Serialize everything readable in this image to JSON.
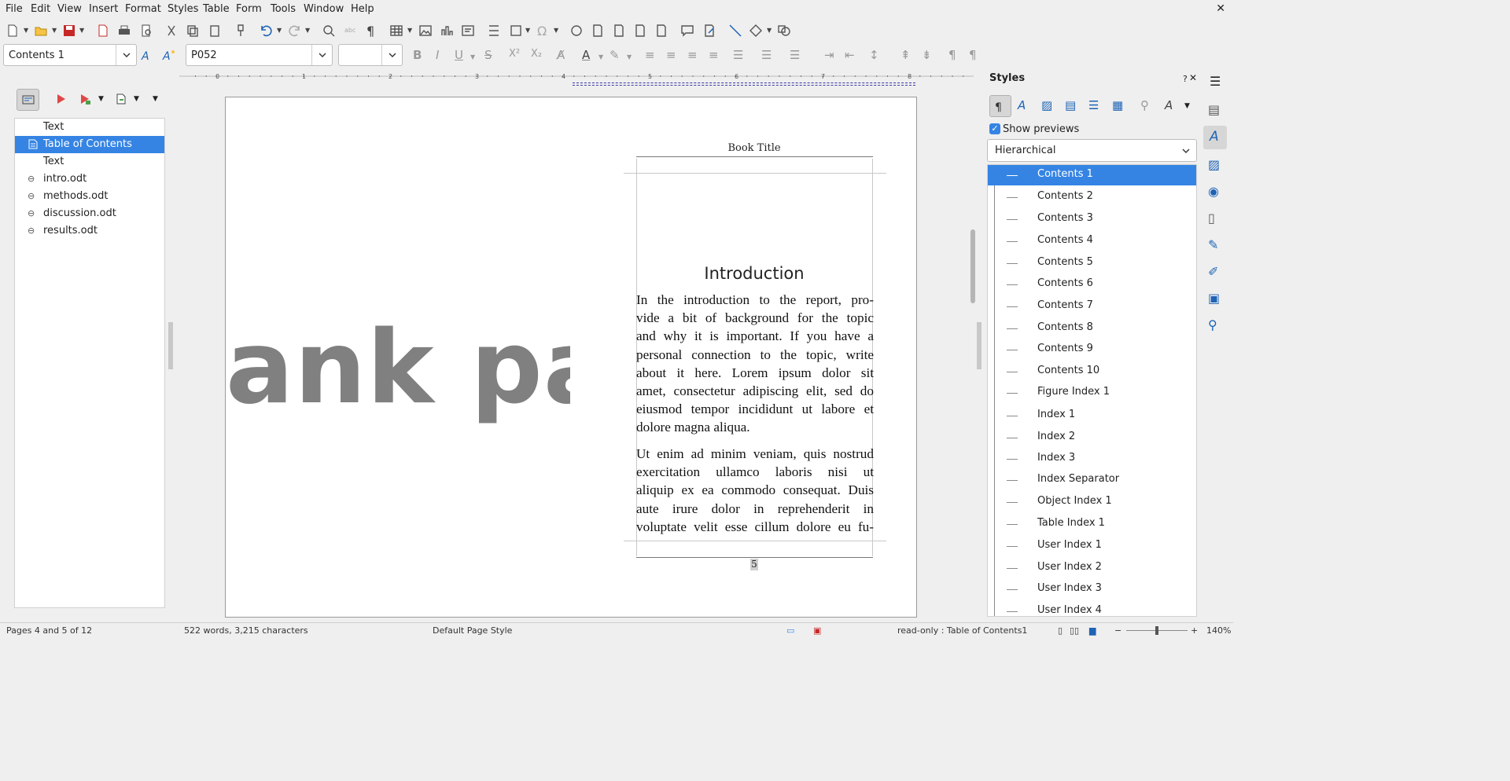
{
  "menu": [
    "File",
    "Edit",
    "View",
    "Insert",
    "Format",
    "Styles",
    "Table",
    "Form",
    "Tools",
    "Window",
    "Help"
  ],
  "toolbar": {
    "paragraph_style": "Contents 1",
    "font_name": "P052",
    "font_size": ""
  },
  "navigator": {
    "items": [
      {
        "label": "Text",
        "icon": "none",
        "selected": false
      },
      {
        "label": "Table of Contents",
        "icon": "section-icon",
        "selected": true
      },
      {
        "label": "Text",
        "icon": "none",
        "selected": false
      },
      {
        "label": "intro.odt",
        "icon": "link-icon",
        "selected": false
      },
      {
        "label": "methods.odt",
        "icon": "link-icon",
        "selected": false
      },
      {
        "label": "discussion.odt",
        "icon": "link-icon",
        "selected": false
      },
      {
        "label": "results.odt",
        "icon": "link-icon",
        "selected": false
      }
    ]
  },
  "document": {
    "blank_page_text": "ank pag",
    "header_title": "Book Title",
    "heading": "Introduction",
    "para1_lines": [
      "In the introduction to the report, pro-",
      "vide a bit of background for the topic",
      "and why it is important. If you have a",
      "personal connection to the topic, write",
      "about it here. Lorem ipsum dolor sit",
      "amet, consectetur adipiscing elit, sed do",
      "eiusmod tempor incididunt ut labore et",
      "dolore magna aliqua."
    ],
    "para2_lines": [
      "Ut enim ad minim veniam, quis nostrud",
      "exercitation ullamco laboris nisi ut",
      "aliquip ex ea commodo consequat. Duis",
      "aute irure dolor in reprehenderit in",
      "voluptate velit esse cillum dolore eu fu-"
    ],
    "page_number": "5"
  },
  "ruler_numbers": [
    "0",
    "1",
    "2",
    "3",
    "4",
    "5",
    "6",
    "7",
    "8"
  ],
  "styles_panel": {
    "title": "Styles",
    "help": "?",
    "show_previews_label": "Show previews",
    "show_previews_checked": true,
    "filter": "Hierarchical",
    "items": [
      "Contents 1",
      "Contents 2",
      "Contents 3",
      "Contents 4",
      "Contents 5",
      "Contents 6",
      "Contents 7",
      "Contents 8",
      "Contents 9",
      "Contents 10",
      "Figure Index 1",
      "Index 1",
      "Index 2",
      "Index 3",
      "Index Separator",
      "Object Index 1",
      "Table Index 1",
      "User Index 1",
      "User Index 2",
      "User Index 3",
      "User Index 4"
    ],
    "selected": "Contents 1"
  },
  "statusbar": {
    "pages": "Pages 4 and 5 of 12",
    "words": "522 words, 3,215 characters",
    "page_style": "Default Page Style",
    "mode": "read-only : Table of Contents1",
    "zoom": "140%"
  },
  "colors": {
    "selection": "#3584e4",
    "background": "#efefef"
  }
}
